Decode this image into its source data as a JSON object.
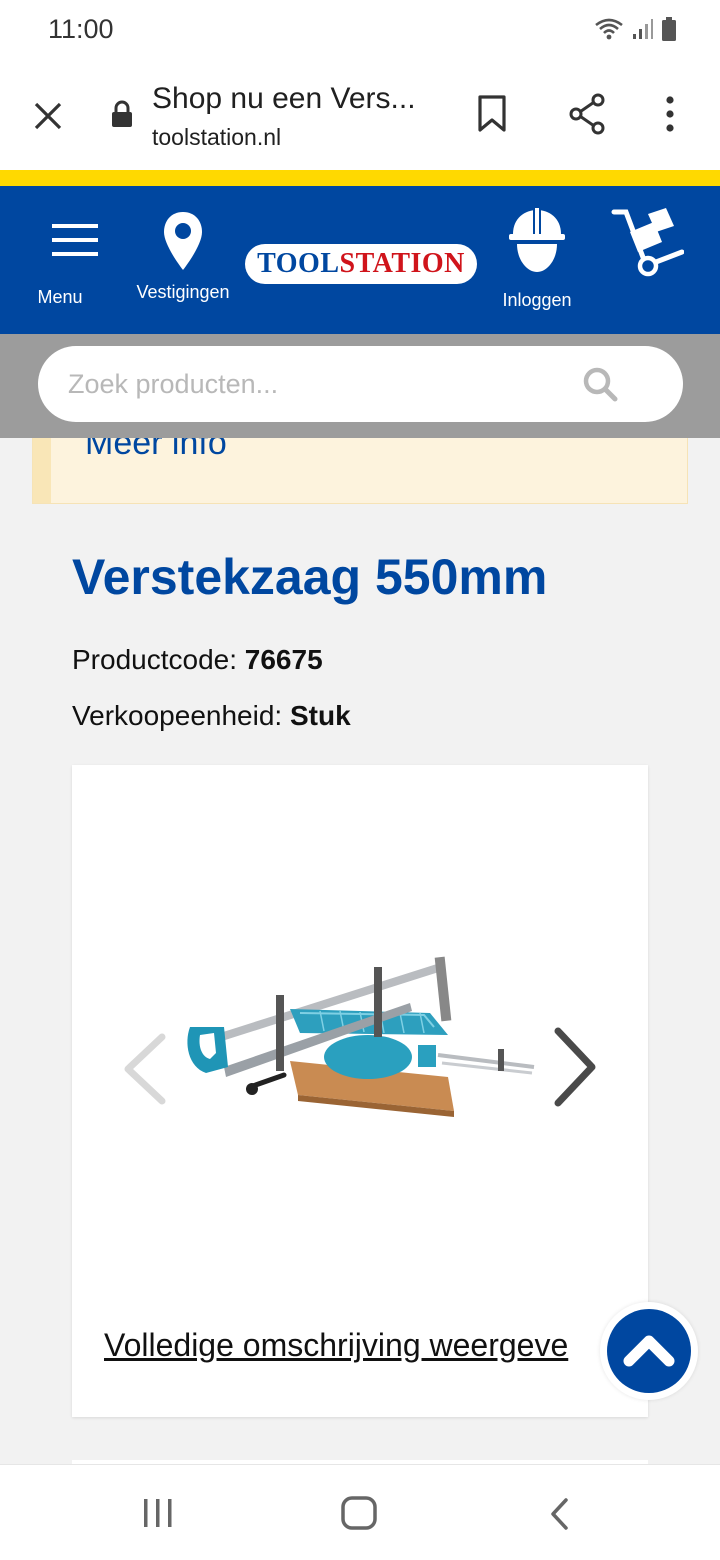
{
  "status_bar": {
    "time": "11:00"
  },
  "browser": {
    "tab_title": "Shop nu een Vers...",
    "url": "toolstation.nl"
  },
  "header": {
    "menu_label": "Menu",
    "locations_label": "Vestigingen",
    "logo_part1": "TOOL",
    "logo_part2": "STATION",
    "login_label": "Inloggen",
    "brand_color": "#0047a0",
    "accent_color": "#ffd900"
  },
  "search": {
    "placeholder": "Zoek producten..."
  },
  "banner": {
    "link": "Meer info"
  },
  "product": {
    "title": "Verstekzaag 550mm",
    "code_label": "Productcode:",
    "code_value": "76675",
    "unit_label": "Verkoopeenheid:",
    "unit_value": "Stuk",
    "description_link": "Volledige omschrijving weergeve"
  }
}
